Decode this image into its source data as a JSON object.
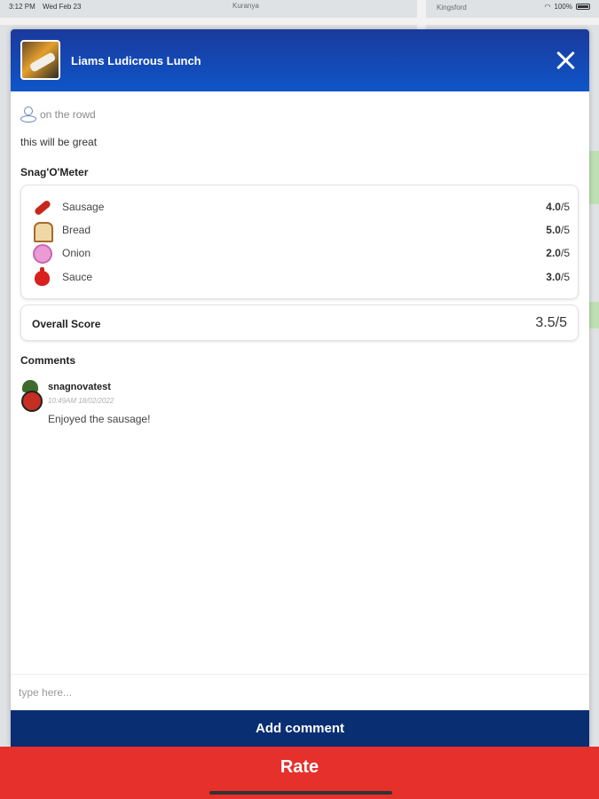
{
  "status_bar": {
    "time": "3:12 PM",
    "date": "Wed Feb 23",
    "battery": "100%"
  },
  "map": {
    "labels": [
      "Kuranya",
      "Kingsford"
    ]
  },
  "modal": {
    "title": "Liams Ludicrous Lunch",
    "location": "on the rowd",
    "description": "this will be great",
    "meter_title": "Snag'O'Meter",
    "ratings": [
      {
        "label": "Sausage",
        "score": "4.0",
        "max": "/5",
        "icon": "sausage-icon"
      },
      {
        "label": "Bread",
        "score": "5.0",
        "max": "/5",
        "icon": "bread-icon"
      },
      {
        "label": "Onion",
        "score": "2.0",
        "max": "/5",
        "icon": "onion-icon"
      },
      {
        "label": "Sauce",
        "score": "3.0",
        "max": "/5",
        "icon": "sauce-icon"
      }
    ],
    "overall_label": "Overall Score",
    "overall_score": "3.5/5",
    "comments_title": "Comments",
    "comments": [
      {
        "user": "snagnovatest",
        "time": "10:49AM 18/02/2022",
        "text": "Enjoyed the sausage!"
      }
    ],
    "comment_placeholder": "type here...",
    "add_comment_label": "Add comment"
  },
  "rate_label": "Rate",
  "colors": {
    "header_blue": "#1444b8",
    "button_navy": "#0a2e72",
    "rate_red": "#e5302b"
  }
}
